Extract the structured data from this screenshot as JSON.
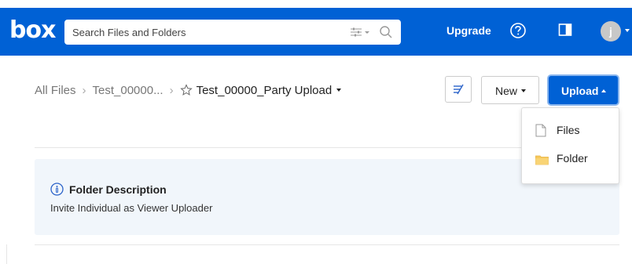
{
  "header": {
    "logo_text": "box",
    "search_placeholder": "Search Files and Folders",
    "upgrade_label": "Upgrade",
    "avatar_initial": "j",
    "brand_color": "#0061d5"
  },
  "breadcrumb": {
    "root": "All Files",
    "parent": "Test_00000...",
    "current": "Test_00000_Party Upload",
    "separator": "›"
  },
  "toolbar": {
    "new_label": "New",
    "upload_label": "Upload"
  },
  "upload_menu": {
    "items": [
      {
        "label": "Files",
        "icon": "file-icon"
      },
      {
        "label": "Folder",
        "icon": "folder-icon"
      }
    ]
  },
  "folder_description": {
    "title": "Folder Description",
    "text": "Invite Individual as Viewer Uploader"
  }
}
